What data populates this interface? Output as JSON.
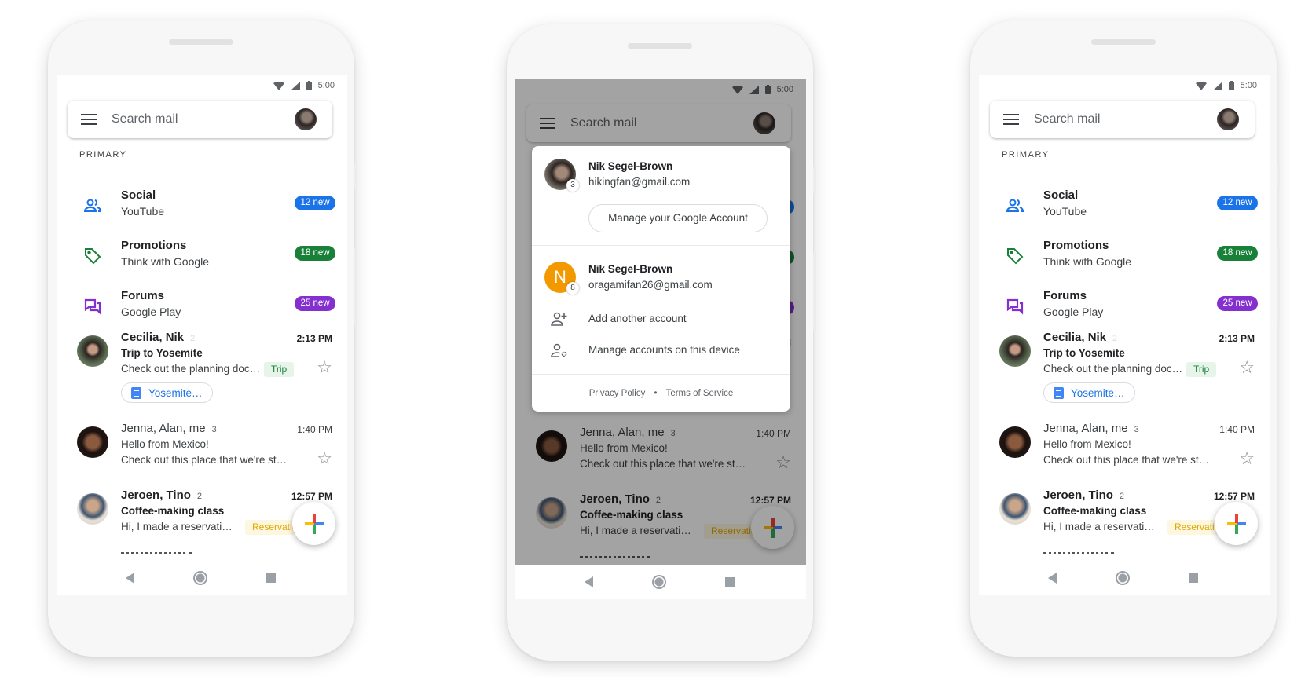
{
  "status": {
    "time": "5:00"
  },
  "search": {
    "placeholder": "Search mail"
  },
  "section_label": "PRIMARY",
  "categories": [
    {
      "title": "Social",
      "subtitle": "YouTube",
      "badge": "12 new",
      "color": "#1a73e8",
      "icon": "people-icon"
    },
    {
      "title": "Promotions",
      "subtitle": "Think with Google",
      "badge": "18 new",
      "color": "#188038",
      "icon": "tag-icon"
    },
    {
      "title": "Forums",
      "subtitle": "Google Play",
      "badge": "25 new",
      "color": "#8430ce",
      "icon": "forum-icon"
    }
  ],
  "emails": [
    {
      "from": "Cecilia, Nik",
      "count": "2",
      "time": "2:13 PM",
      "subject": "Trip to Yosemite",
      "snippet": "Check out the planning doc…",
      "label": "Trip",
      "attachment": "Yosemite…",
      "unread": true
    },
    {
      "from": "Jenna, Alan, me",
      "count": "3",
      "time": "1:40 PM",
      "subject": "Hello from Mexico!",
      "snippet": "Check out this place that we're st…",
      "unread": false
    },
    {
      "from": "Jeroen, Tino",
      "count": "2",
      "time": "12:57 PM",
      "subject": "Coffee-making class",
      "snippet": "Hi, I made a reservati…",
      "label": "Reservation",
      "unread": true
    }
  ],
  "account_menu": {
    "primary": {
      "name": "Nik Segel-Brown",
      "email": "hikingfan@gmail.com",
      "count": "3",
      "manage_label": "Manage your Google Account"
    },
    "secondary": {
      "name": "Nik Segel-Brown",
      "email": "oragamifan26@gmail.com",
      "count": "8",
      "initial": "N",
      "avatar_color": "#f29900"
    },
    "add_account": "Add another account",
    "manage_device": "Manage accounts on this device",
    "privacy": "Privacy Policy",
    "separator": "•",
    "terms": "Terms of Service"
  },
  "colors": {
    "trip_bg": "#e6f4ea",
    "trip_fg": "#188038",
    "reservation_bg": "#fef7e0",
    "reservation_fg": "#e0a800"
  }
}
